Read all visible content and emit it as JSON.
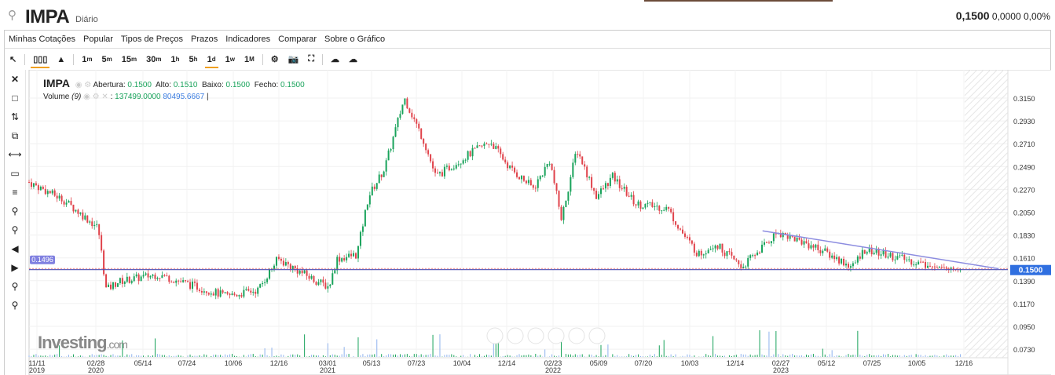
{
  "header": {
    "search_icon": "search-icon",
    "symbol": "IMPA",
    "period": "Diário",
    "price": "0,1500",
    "change": "0,0000",
    "change_pct": "0,00%"
  },
  "menu": [
    "Minhas Cotações",
    "Popular",
    "Tipos de Preços",
    "Prazos",
    "Indicadores",
    "Comparar",
    "Sobre o Gráfico"
  ],
  "toolbar": {
    "intervals": [
      {
        "n": "1",
        "u": "m"
      },
      {
        "n": "5",
        "u": "m"
      },
      {
        "n": "15",
        "u": "m"
      },
      {
        "n": "30",
        "u": "m"
      },
      {
        "n": "1",
        "u": "h"
      },
      {
        "n": "5",
        "u": "h"
      },
      {
        "n": "1",
        "u": "d"
      },
      {
        "n": "1",
        "u": "w"
      },
      {
        "n": "1",
        "u": "M"
      }
    ],
    "active_interval": 6
  },
  "legend": {
    "symbol": "IMPA",
    "open_label": "Abertura:",
    "open": "0.1500",
    "high_label": "Alto:",
    "high": "0.1510",
    "low_label": "Baixo:",
    "low": "0.1500",
    "close_label": "Fecho:",
    "close": "0.1500",
    "volume_label": "Volume",
    "volume_period": "(9)",
    "volume": "137499.0000",
    "volume_ma": "80495.6667"
  },
  "watermark": {
    "brand": "Investing",
    "suffix": ".com"
  },
  "colors": {
    "up": "#19a35b",
    "down": "#e0434b",
    "line": "#4b4bb0",
    "trend": "#8c8ce0",
    "volume": "#8fb3ee",
    "price_tag": "#2f6fe0",
    "hline_tag": "#8080e0"
  },
  "chart_data": {
    "type": "candlestick",
    "y_ticks": [
      "0.3150",
      "0.2930",
      "0.2710",
      "0.2490",
      "0.2270",
      "0.2050",
      "0.1830",
      "0.1610",
      "0.1390",
      "0.1170",
      "0.0950",
      "0.0730"
    ],
    "ylim": [
      0.073,
      0.315
    ],
    "x_ticks": [
      [
        "11/11",
        "2019"
      ],
      [
        "02/28",
        "2020"
      ],
      [
        "05/14",
        ""
      ],
      [
        "07/24",
        ""
      ],
      [
        "10/06",
        ""
      ],
      [
        "12/16",
        ""
      ],
      [
        "03/01",
        "2021"
      ],
      [
        "05/13",
        ""
      ],
      [
        "07/23",
        ""
      ],
      [
        "10/04",
        ""
      ],
      [
        "12/14",
        ""
      ],
      [
        "02/23",
        "2022"
      ],
      [
        "05/09",
        ""
      ],
      [
        "07/20",
        ""
      ],
      [
        "10/03",
        ""
      ],
      [
        "12/14",
        ""
      ],
      [
        "02/27",
        "2023"
      ],
      [
        "05/12",
        ""
      ],
      [
        "07/25",
        ""
      ],
      [
        "10/05",
        ""
      ],
      [
        "12/16",
        ""
      ]
    ],
    "price_path_day_close": [
      [
        0,
        0.234
      ],
      [
        38,
        0.217
      ],
      [
        77,
        0.19
      ],
      [
        86,
        0.13
      ],
      [
        99,
        0.138
      ],
      [
        143,
        0.145
      ],
      [
        220,
        0.124
      ],
      [
        255,
        0.13
      ],
      [
        277,
        0.16
      ],
      [
        317,
        0.14
      ],
      [
        334,
        0.133
      ],
      [
        343,
        0.16
      ],
      [
        365,
        0.164
      ],
      [
        378,
        0.22
      ],
      [
        396,
        0.247
      ],
      [
        418,
        0.315
      ],
      [
        440,
        0.273
      ],
      [
        453,
        0.239
      ],
      [
        492,
        0.262
      ],
      [
        514,
        0.273
      ],
      [
        536,
        0.247
      ],
      [
        562,
        0.228
      ],
      [
        580,
        0.255
      ],
      [
        593,
        0.198
      ],
      [
        610,
        0.266
      ],
      [
        632,
        0.22
      ],
      [
        650,
        0.239
      ],
      [
        676,
        0.213
      ],
      [
        711,
        0.209
      ],
      [
        729,
        0.183
      ],
      [
        746,
        0.164
      ],
      [
        764,
        0.175
      ],
      [
        794,
        0.152
      ],
      [
        834,
        0.186
      ],
      [
        877,
        0.171
      ],
      [
        917,
        0.152
      ],
      [
        930,
        0.169
      ],
      [
        974,
        0.16
      ],
      [
        1009,
        0.152
      ],
      [
        1040,
        0.15
      ]
    ],
    "horizontal_line": {
      "value": 0.1496,
      "label": "0.1496"
    },
    "last_price": {
      "value": 0.15,
      "label": "0.1500"
    },
    "trendline": {
      "from": [
        817,
        0.187
      ],
      "to": [
        1080,
        0.1505
      ]
    }
  }
}
